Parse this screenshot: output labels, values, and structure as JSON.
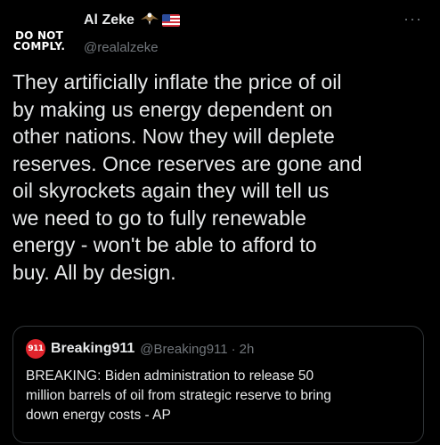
{
  "tweet": {
    "avatar_line1": "DO NOT",
    "avatar_line2": "COMPLY.",
    "display_name": "Al Zeke",
    "badges": [
      "eagle-emoji",
      "us-flag-emoji"
    ],
    "handle": "@realalzeke",
    "more_label": "···",
    "text": "They artificially inflate the price of oil\nby making us energy dependent on\nother nations. Now they will deplete\nreserves. Once reserves are gone and\noil skyrockets again they will tell us\nwe need to go to fully renewable\nenergy - won't be able to afford to\nbuy. All by design."
  },
  "quote": {
    "avatar_text": "911",
    "display_name": "Breaking911",
    "handle": "@Breaking911",
    "separator": "·",
    "time": "2h",
    "text": "BREAKING: Biden administration to release 50\nmillion barrels of oil from strategic reserve to bring\ndown energy costs - AP"
  },
  "colors": {
    "background": "#000000",
    "text_primary": "#e7e9ea",
    "text_secondary": "#71767b",
    "border": "#2f3336",
    "quote_avatar": "#e0242c"
  }
}
